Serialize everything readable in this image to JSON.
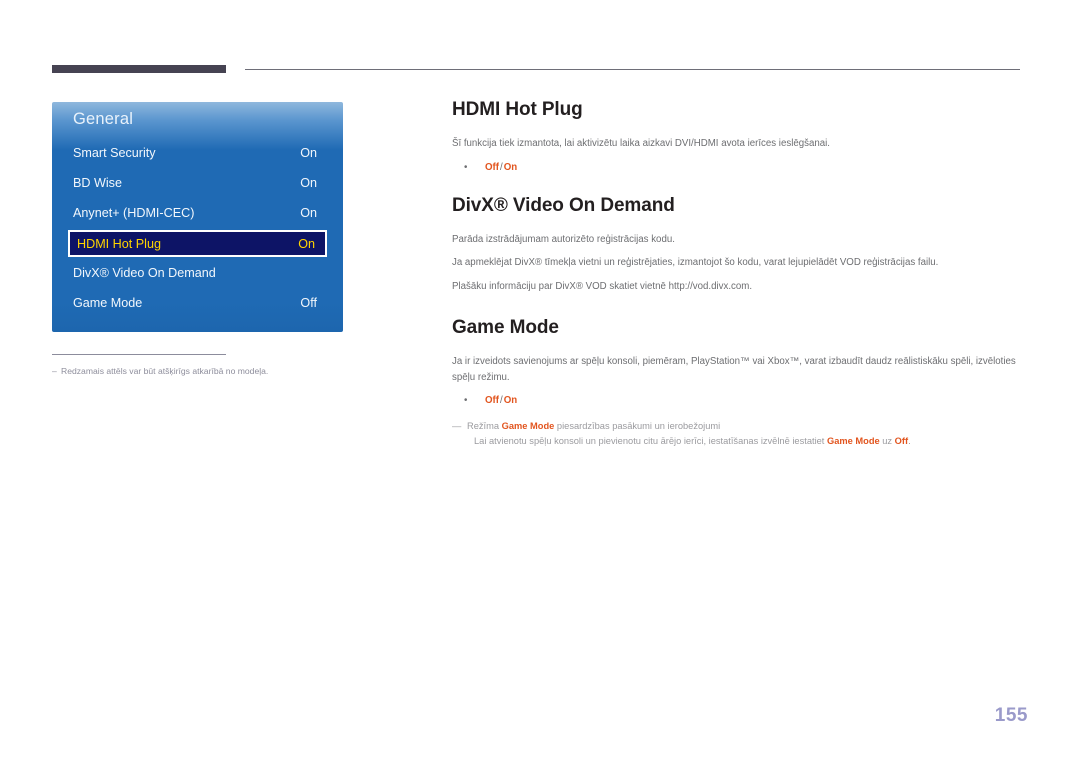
{
  "header": {
    "rule_left_color": "#464352",
    "rule_right_color": "#6e6e78"
  },
  "osd_menu": {
    "title": "General",
    "rows": [
      {
        "label": "Smart Security",
        "value": "On",
        "selected": false
      },
      {
        "label": "BD Wise",
        "value": "On",
        "selected": false
      },
      {
        "label": "Anynet+ (HDMI-CEC)",
        "value": "On",
        "selected": false
      },
      {
        "label": "HDMI Hot Plug",
        "value": "On",
        "selected": true
      },
      {
        "label": "DivX® Video On Demand",
        "value": "",
        "selected": false
      },
      {
        "label": "Game Mode",
        "value": "Off",
        "selected": false
      }
    ],
    "highlight_bg": "#0d1466",
    "highlight_text": "#ffd400",
    "panel_color": "#1f6ab4"
  },
  "figure_note": {
    "dash": "–",
    "text": "Redzamais attēls var būt atšķirīgs atkarībā no modeļa."
  },
  "sections": [
    {
      "id": "hdmi-hot-plug",
      "heading": "HDMI Hot Plug",
      "paragraphs": [
        "Šī funkcija tiek izmantota, lai aktivizētu laika aizkavi DVI/HDMI avota ierīces ieslēgšanai."
      ],
      "options": {
        "first": "Off",
        "separator": "/",
        "second": "On"
      }
    },
    {
      "id": "divx-video-on-demand",
      "heading": "DivX® Video On Demand",
      "paragraphs": [
        "Parāda izstrādājumam autorizēto reģistrācijas kodu.",
        "Ja apmeklējat DivX® tīmekļa vietni un reģistrējaties, izmantojot šo kodu, varat lejupielādēt VOD reģistrācijas failu.",
        "Plašāku informāciju par DivX® VOD skatiet vietnē http://vod.divx.com."
      ],
      "options": null
    },
    {
      "id": "game-mode",
      "heading": "Game Mode",
      "paragraphs": [
        "Ja ir izveidots savienojums ar spēļu konsoli, piemēram, PlayStation™ vai Xbox™, varat izbaudīt daudz reālistiskāku spēli, izvēloties spēļu režimu."
      ],
      "options": {
        "first": "Off",
        "separator": "/",
        "second": "On"
      }
    }
  ],
  "game_mode_notes": {
    "dash": "—",
    "line1_before": "Režīma ",
    "line1_hl": "Game Mode",
    "line1_after": " piesardzības pasākumi un ierobežojumi",
    "line2_before": "Lai atvienotu spēļu konsoli un pievienotu citu ārējo ierīci, iestatīšanas izvēlnē iestatiet ",
    "line2_hl1": "Game Mode",
    "line2_mid": " uz ",
    "line2_hl2": "Off",
    "line2_end": "."
  },
  "page_number": "155",
  "colors": {
    "accent_orange": "#e2551f",
    "body_gray": "#6d6e71",
    "note_gray": "#9b9b9f",
    "page_number": "#9a9aca"
  }
}
